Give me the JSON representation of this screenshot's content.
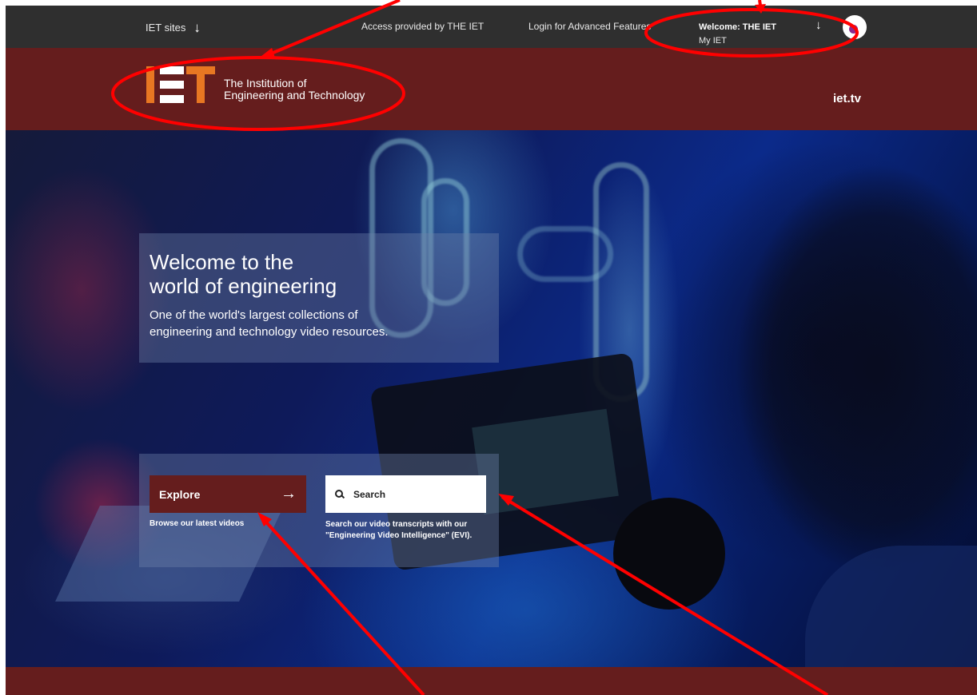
{
  "topbar": {
    "iet_sites": "IET sites",
    "access_label": "Access provided by",
    "access_org": "THE IET",
    "login": "Login for Advanced Features",
    "welcome": "Welcome: THE IET",
    "my_iet": "My IET"
  },
  "brand": {
    "logo_line1": "The Institution of",
    "logo_line2": "Engineering and Technology",
    "site_name": "iet.tv"
  },
  "hero": {
    "title_line1": "Welcome to the",
    "title_line2": "world of engineering",
    "subtitle_line1": "One of the world's largest collections of",
    "subtitle_line2": "engineering and technology video resources.",
    "explore_label": "Explore",
    "explore_desc": "Browse our latest videos",
    "search_label": "Search",
    "search_desc_line1": "Search our video transcripts with our",
    "search_desc_line2": "\"Engineering Video Intelligence\" (EVI)."
  },
  "colors": {
    "topbar": "#2f2f2f",
    "brand": "#651d1d",
    "logo_orange": "#e87722",
    "annotation_red": "#ff0000"
  },
  "icons": [
    "arrow-down-icon",
    "avatar-icon",
    "search-icon",
    "arrow-right-icon"
  ]
}
